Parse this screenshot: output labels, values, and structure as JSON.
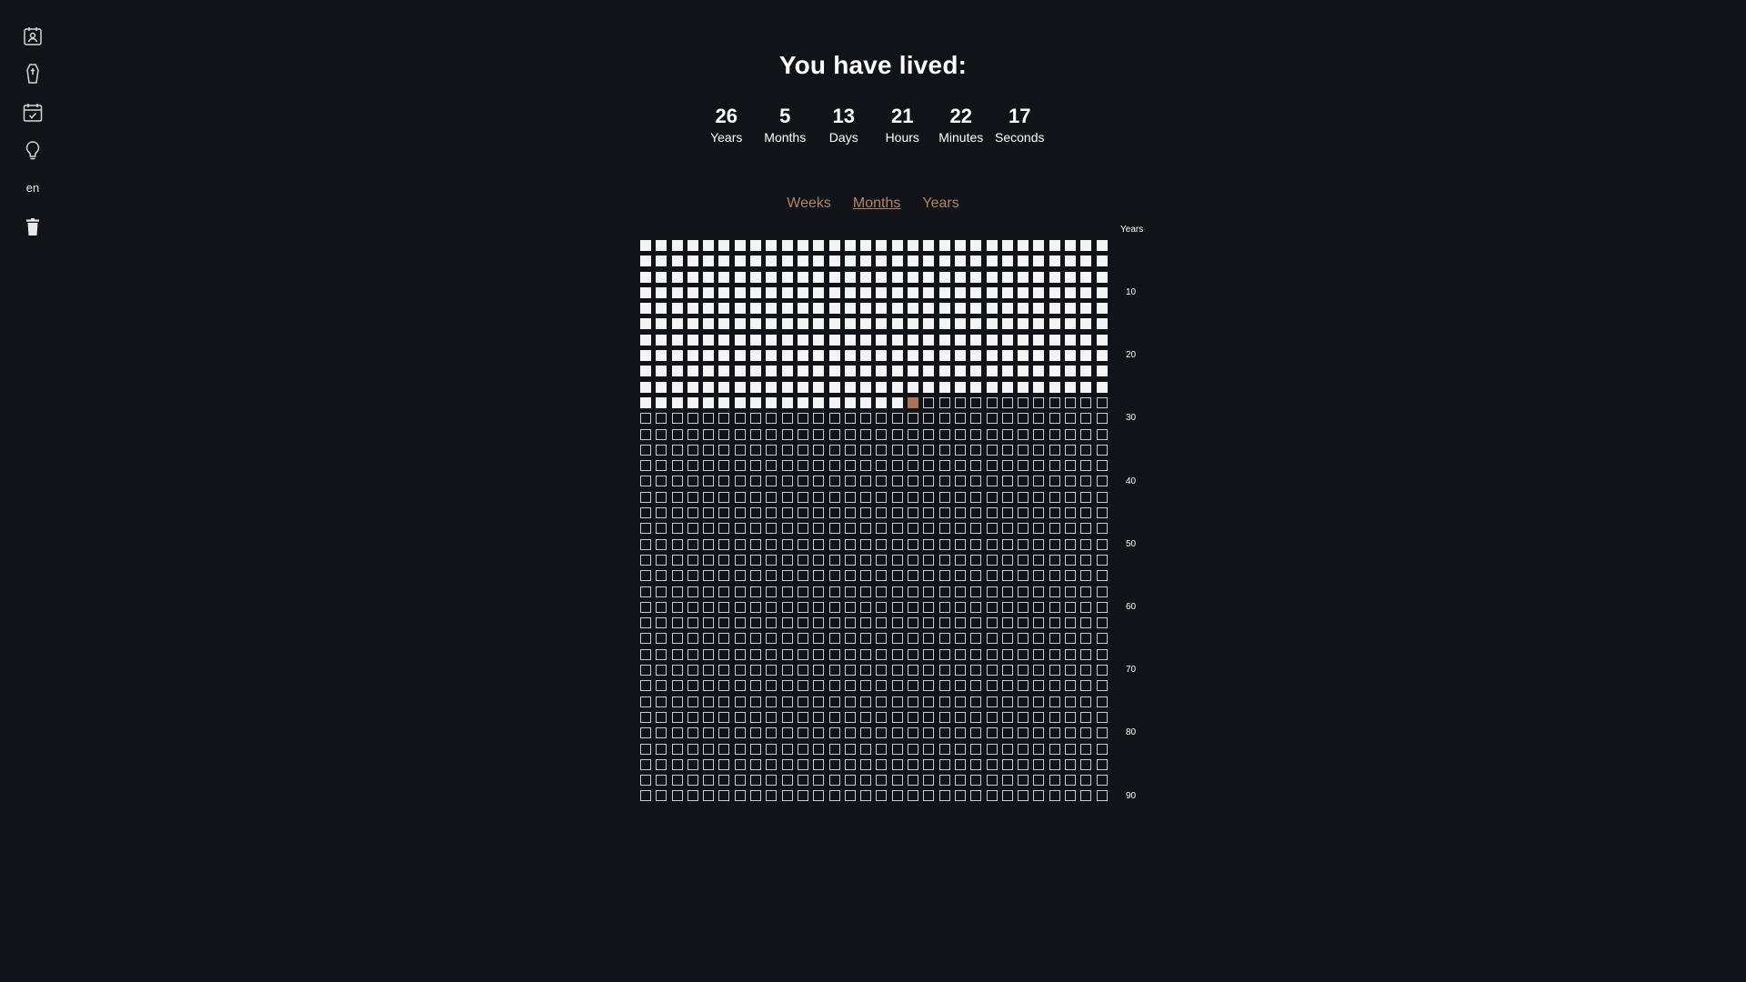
{
  "sidebar": {
    "items": [
      {
        "icon": "profile-calendar-icon"
      },
      {
        "icon": "coffin-icon"
      },
      {
        "icon": "calendar-check-icon"
      },
      {
        "icon": "lightbulb-icon"
      },
      {
        "label": "en"
      },
      {
        "icon": "trash-icon"
      }
    ]
  },
  "header": {
    "title": "You have lived:"
  },
  "counters": [
    {
      "value": "26",
      "label": "Years"
    },
    {
      "value": "5",
      "label": "Months"
    },
    {
      "value": "13",
      "label": "Days"
    },
    {
      "value": "21",
      "label": "Hours"
    },
    {
      "value": "22",
      "label": "Minutes"
    },
    {
      "value": "17",
      "label": "Seconds"
    }
  ],
  "views": {
    "tabs": [
      "Weeks",
      "Months",
      "Years"
    ],
    "active": "Months"
  },
  "grid": {
    "header": "Years",
    "columns": 30,
    "rows": 36,
    "lived_cells": 317,
    "current_cell": 318,
    "row_labels": [
      "10",
      "20",
      "30",
      "40",
      "50",
      "60",
      "70",
      "80",
      "90"
    ]
  },
  "colors": {
    "background": "#111318",
    "accent": "#b08468",
    "current": "#a9735a",
    "lived": "#f4f4f6",
    "empty_border": "#c9cbd2"
  }
}
